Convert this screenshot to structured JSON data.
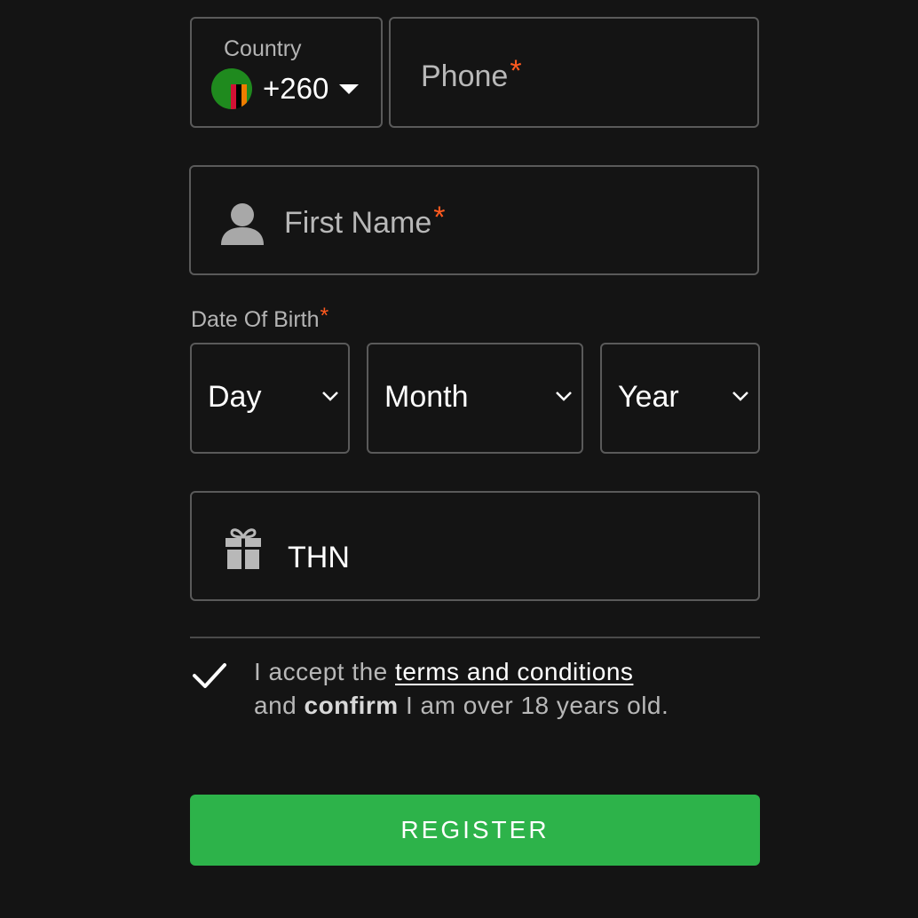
{
  "country": {
    "label": "Country",
    "flag_icon": "zambia-flag-icon",
    "code": "+260"
  },
  "phone": {
    "placeholder": "Phone",
    "required_mark": "*"
  },
  "first_name": {
    "icon": "user-icon",
    "placeholder": "First Name",
    "required_mark": "*"
  },
  "dob": {
    "label": "Date Of Birth",
    "required_mark": "*",
    "day": "Day",
    "month": "Month",
    "year": "Year"
  },
  "promo": {
    "icon": "gift-icon",
    "value": "THN"
  },
  "terms": {
    "checked": true,
    "text_before": "I accept the ",
    "link": "terms and conditions",
    "text_and": "and ",
    "bold": "confirm",
    "text_after": " I am over 18 years old."
  },
  "register_label": "REGISTER",
  "colors": {
    "background": "#141414",
    "border": "#5a5a5a",
    "required": "#ff5a1f",
    "primary_button": "#2db34a"
  }
}
